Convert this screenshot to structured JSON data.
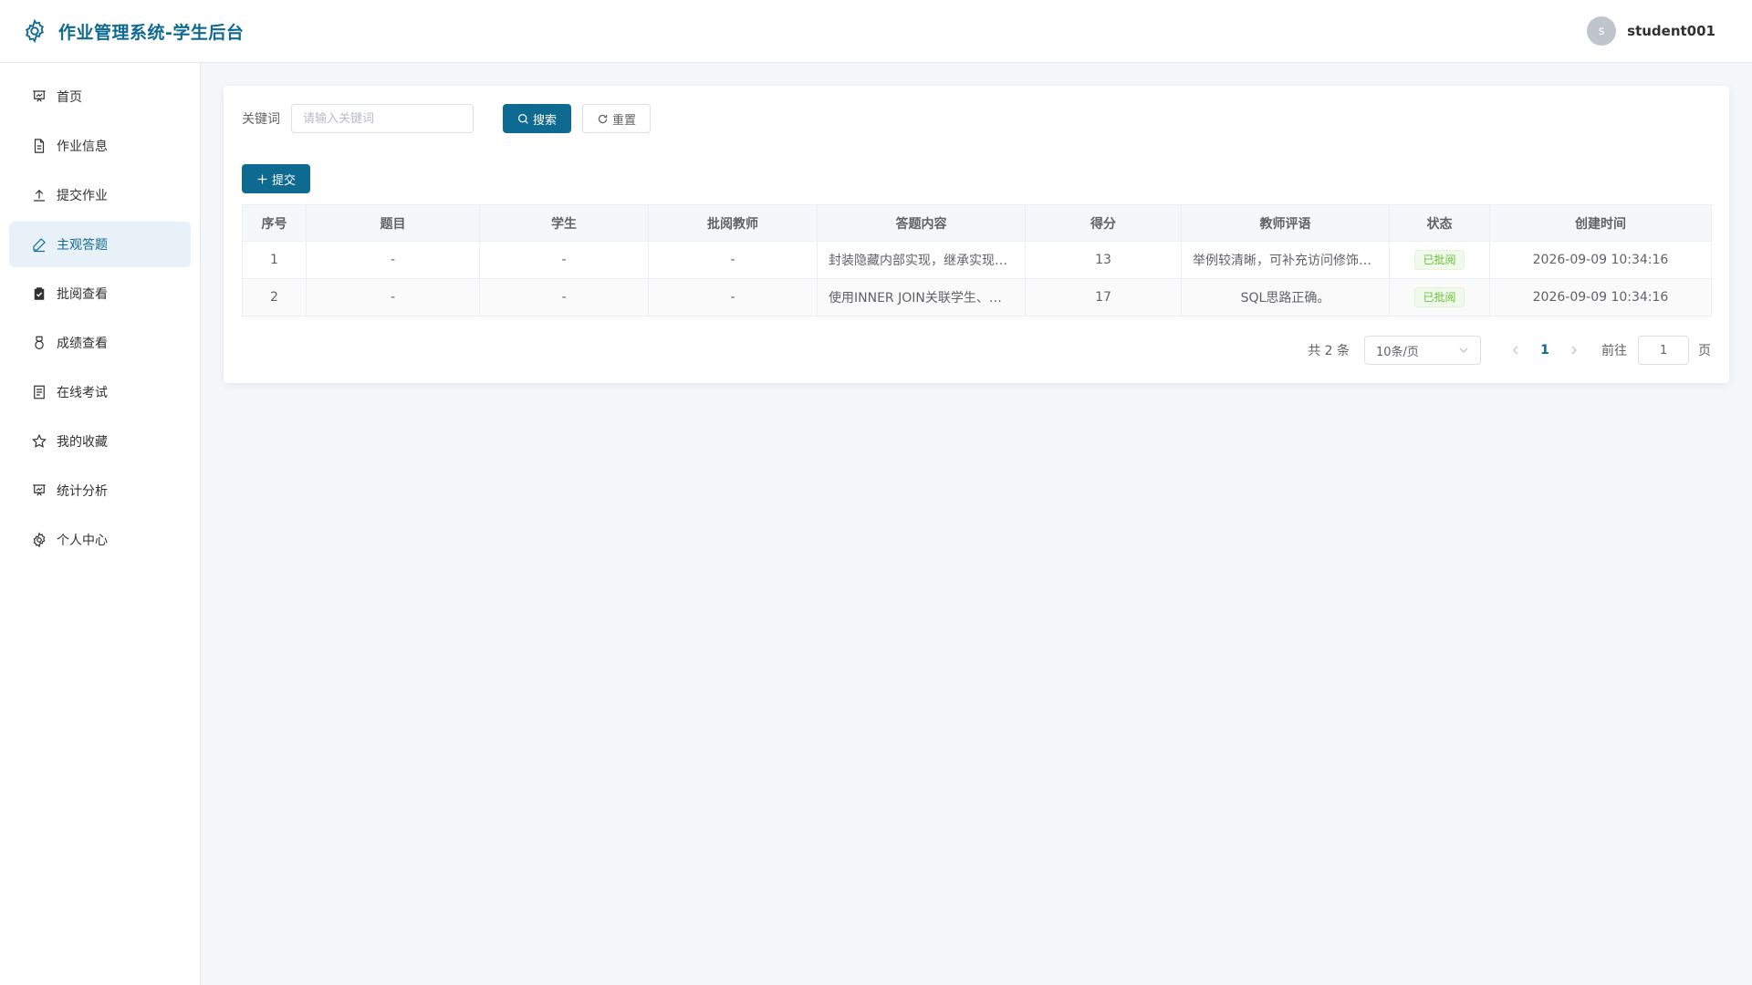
{
  "header": {
    "title": "作业管理系统-学生后台",
    "avatar_letter": "s",
    "username": "student001"
  },
  "sidebar": {
    "items": [
      {
        "label": "首页",
        "icon": "presentation-icon"
      },
      {
        "label": "作业信息",
        "icon": "document-icon"
      },
      {
        "label": "提交作业",
        "icon": "upload-icon"
      },
      {
        "label": "主观答题",
        "icon": "edit-pen-icon",
        "active": true
      },
      {
        "label": "批阅查看",
        "icon": "clipboard-check-icon"
      },
      {
        "label": "成绩查看",
        "icon": "medal-icon"
      },
      {
        "label": "在线考试",
        "icon": "exam-paper-icon"
      },
      {
        "label": "我的收藏",
        "icon": "star-icon"
      },
      {
        "label": "统计分析",
        "icon": "chart-board-icon"
      },
      {
        "label": "个人中心",
        "icon": "gear-icon"
      }
    ]
  },
  "search": {
    "label": "关键词",
    "placeholder": "请输入关键词",
    "search_button": "搜索",
    "reset_button": "重置"
  },
  "toolbar": {
    "add_button": "提交"
  },
  "table": {
    "columns": [
      "序号",
      "题目",
      "学生",
      "批阅教师",
      "答题内容",
      "得分",
      "教师评语",
      "状态",
      "创建时间"
    ],
    "rows": [
      {
        "index": "1",
        "question": "-",
        "student": "-",
        "teacher": "-",
        "content": "封装隐藏内部实现，继承实现代码复用，多态提高扩展性。",
        "score": "13",
        "comment": "举例较清晰，可补充访问修饰符。",
        "status": "已批阅",
        "created": "2026-09-09 10:34:16"
      },
      {
        "index": "2",
        "question": "-",
        "student": "-",
        "teacher": "-",
        "content": "使用INNER JOIN关联学生、课程和成绩表。",
        "score": "17",
        "comment": "SQL思路正确。",
        "status": "已批阅",
        "created": "2026-09-09 10:34:16"
      }
    ]
  },
  "pagination": {
    "total_text": "共 2 条",
    "page_size": "10条/页",
    "current_page": "1",
    "goto_label": "前往",
    "goto_value": "1",
    "page_suffix": "页"
  },
  "colors": {
    "primary": "#0f6a92",
    "status_success": "#67c23a",
    "active_bg": "#e8f1f8"
  }
}
